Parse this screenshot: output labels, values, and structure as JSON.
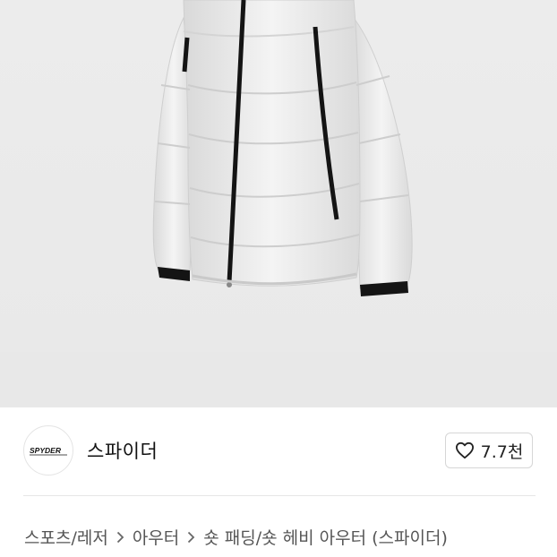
{
  "product": {
    "image_alt": "Spyder white short down puffer jacket with black zipper trim",
    "jacket_color": "#f1f1f1",
    "trim_color": "#141414"
  },
  "brand": {
    "logo_text": "SPYDER",
    "name": "스파이더",
    "likes": "7.7천"
  },
  "breadcrumb": {
    "items": [
      "스포츠/레저",
      "아우터",
      "숏 패딩/숏 헤비 아우터 (스파이더)"
    ],
    "separator_icon": "chevron-right-icon"
  }
}
